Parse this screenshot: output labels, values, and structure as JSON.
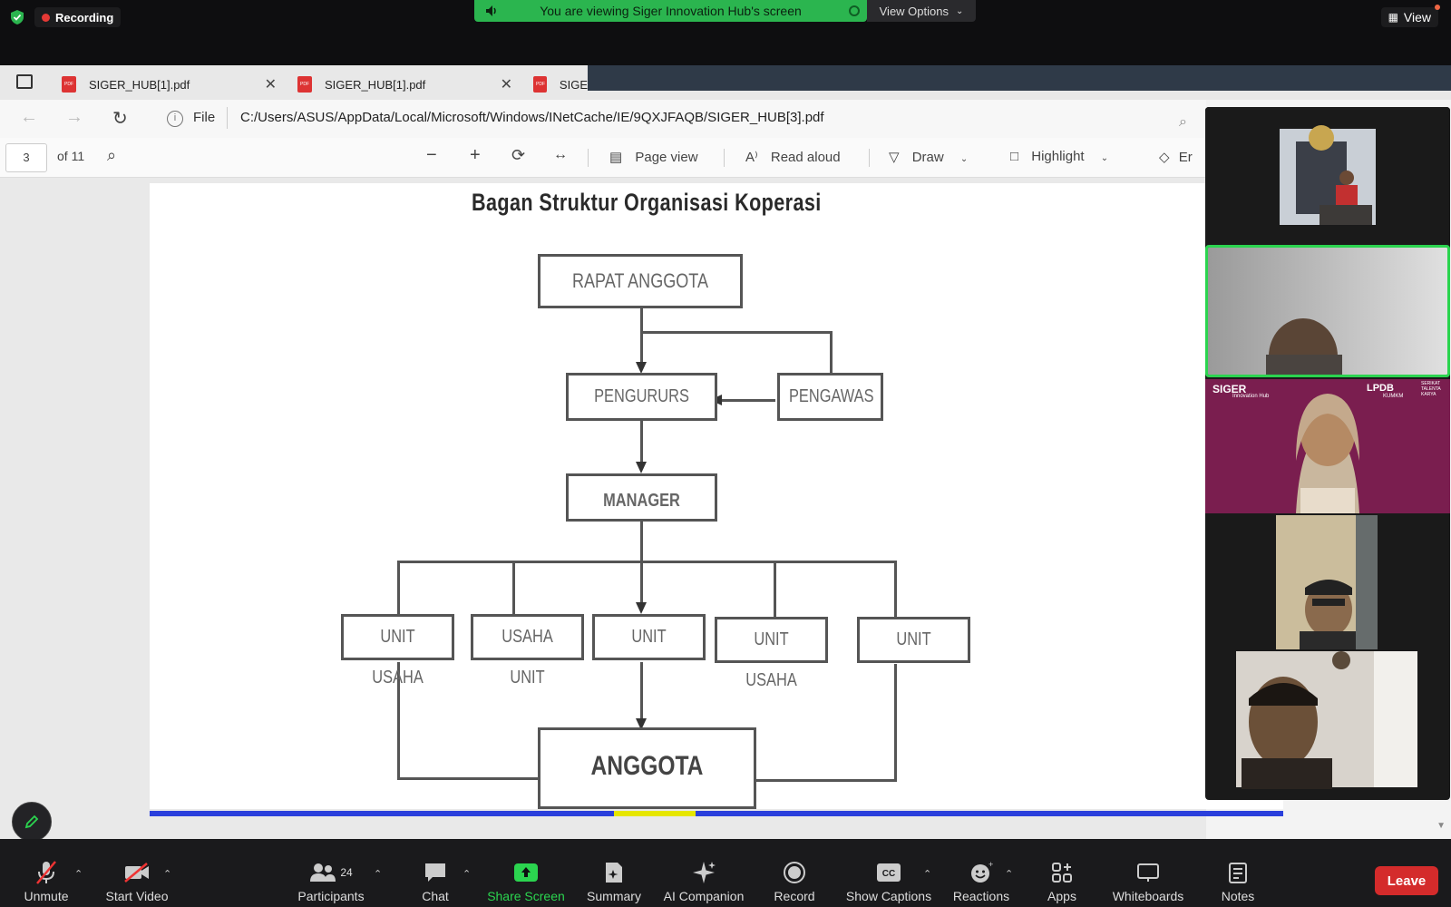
{
  "meeting": {
    "recording_label": "Recording",
    "share_banner_text": "You are viewing Siger Innovation Hub's screen",
    "view_options_label": "View Options",
    "view_label": "View"
  },
  "browser": {
    "tabs": [
      {
        "title": "SIGER_HUB[1].pdf"
      },
      {
        "title": "SIGER_HUB[1].pdf"
      },
      {
        "title": "SIGE"
      }
    ],
    "address_prefix": "File",
    "address_url": "C:/Users/ASUS/AppData/Local/Microsoft/Windows/INetCache/IE/9QXJFAQB/SIGER_HUB[3].pdf"
  },
  "pdf_toolbar": {
    "page_number": "3",
    "page_total": "of 11",
    "page_view_label": "Page view",
    "read_aloud_label": "Read aloud",
    "draw_label": "Draw",
    "highlight_label": "Highlight",
    "erase_label": "Er"
  },
  "org_chart": {
    "title": "Bagan Struktur Organisasi Koperasi",
    "top": "RAPAT ANGGOTA",
    "board": "PENGURURS",
    "supervisor": "PENGAWAS",
    "manager": "MANAGER",
    "units": [
      "UNIT USAHA",
      "USAHA UNIT",
      "UNIT",
      "UNIT USAHA",
      "UNIT"
    ],
    "members": "ANGGOTA"
  },
  "video_tiles": {
    "banner_left": "SIGER",
    "banner_left_sub": "Innovation Hub",
    "banner_mid": "LPDB",
    "banner_mid_sub": "KUMKM",
    "banner_right": "SERIKAT TALENTA KARYA"
  },
  "bottom_bar": {
    "unmute": "Unmute",
    "start_video": "Start Video",
    "participants": "Participants",
    "participants_count": "24",
    "chat": "Chat",
    "share_screen": "Share Screen",
    "summary": "Summary",
    "ai_companion": "AI Companion",
    "record": "Record",
    "show_captions": "Show Captions",
    "reactions": "Reactions",
    "apps": "Apps",
    "whiteboards": "Whiteboards",
    "notes": "Notes",
    "leave": "Leave"
  },
  "colors": {
    "share_green": "#2bb54f",
    "active_speaker": "#2bd44f",
    "leave_red": "#d42b2b",
    "tile_purple": "#7a1e4f"
  }
}
